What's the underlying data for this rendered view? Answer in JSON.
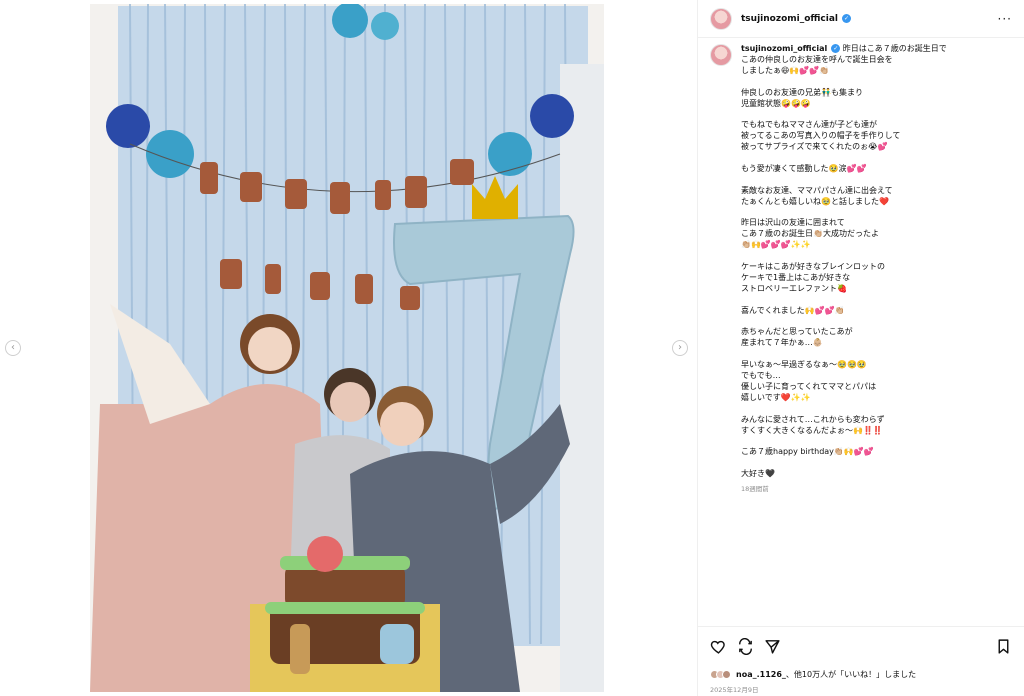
{
  "post": {
    "username": "tsujinozomi_official",
    "caption_lines": [
      "昨日はこあ７歳のお誕生日で",
      "こあの仲良しのお友達を呼んで誕生日会を",
      "しましたぁ😆🙌💕💕👏🏼",
      "",
      "仲良しのお友達の兄弟👬も集まり",
      "児童館状態🤪🤪🤪",
      "",
      "でもねでもねママさん達が子ども達が",
      "被ってるこあの写真入りの帽子を手作りして",
      "被ってサプライズで来てくれたのぉ😭💕",
      "",
      "もう愛が凄くて感動した🥹涙💕💕",
      "",
      "素敵なお友達、ママパパさん達に出会えて",
      "たぁくんとも嬉しいね🥹と話しました❤️",
      "",
      "昨日は沢山の友達に囲まれて",
      "こあ７歳のお誕生日👏🏼大成功だったよ",
      "👏🏼🙌💕💕💕✨✨",
      "",
      "ケーキはこあが好きなブレインロットの",
      "ケーキで1番上はこあが好きな",
      "ストロベリーエレファント🍓",
      "",
      "喜んでくれました🙌💕💕👏🏼",
      "",
      "赤ちゃんだと思っていたこあが",
      "産まれて７年かぁ…👶🏼",
      "",
      "早いなぁ〜早過ぎるなぁ〜🥹🥹🥹",
      "でもでも…",
      "優しい子に育ってくれてママとパパは",
      "嬉しいです❤️✨✨",
      "",
      "みんなに愛されて…これからも変わらず",
      "すくすく大きくなるんだよぉ〜🙌‼️‼️",
      "",
      "こあ７歳happy birthday👏🏼🙌💕💕",
      "",
      "大好き🖤"
    ],
    "time_ago": "18週間前",
    "likes_text_user": "noa_.1126_",
    "likes_text_rest": "、他10万人が「いいね！」しました",
    "date": "2025年12月9日"
  },
  "icons": {
    "more": "more-options-icon",
    "like": "heart-icon",
    "repost": "repost-icon",
    "share": "share-icon",
    "save": "bookmark-icon",
    "prev": "chevron-left-icon",
    "next": "chevron-right-icon"
  },
  "colors": {
    "verified": "#3897f0",
    "muted_text": "#8e8e8e",
    "balloon": "#a9c9d8",
    "curtain": "#b7cfe6"
  }
}
